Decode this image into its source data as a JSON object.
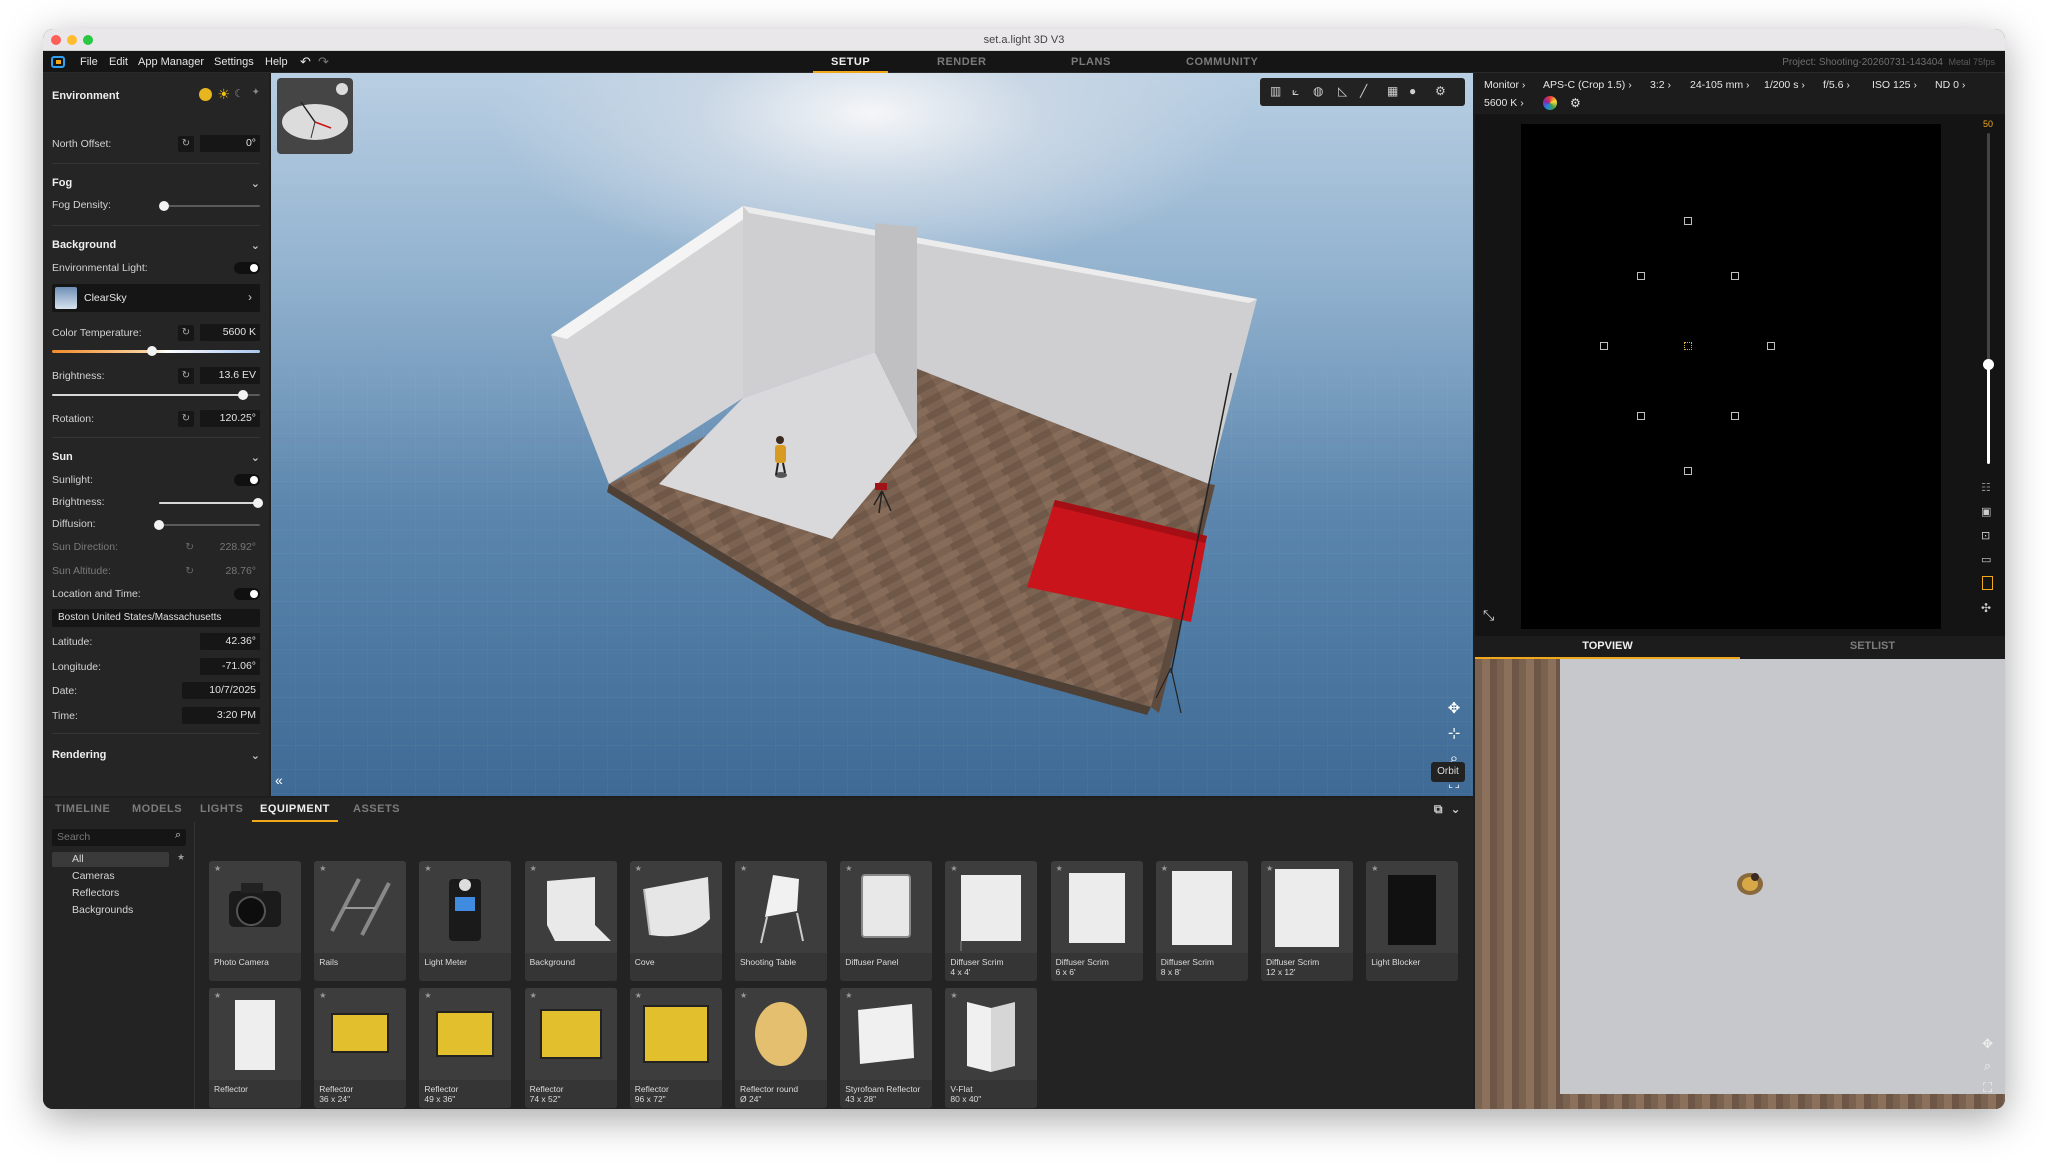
{
  "window": {
    "title": "set.a.light 3D V3"
  },
  "menu": {
    "items": [
      "File",
      "Edit",
      "App Manager",
      "Settings",
      "Help"
    ],
    "undo": "↶",
    "redo": "↷"
  },
  "modes": {
    "setup": "SETUP",
    "render": "RENDER",
    "plans": "PLANS",
    "community": "COMMUNITY"
  },
  "project": {
    "label": "Project: Shooting-20260731-143404",
    "fps": "Metal 75fps"
  },
  "environment": {
    "title": "Environment",
    "north_offset_label": "North Offset:",
    "north_offset": "0°",
    "fog_title": "Fog",
    "fog_density_label": "Fog Density:",
    "fog_density": 0.0,
    "background_title": "Background",
    "env_light_label": "Environmental Light:",
    "sky_name": "ClearSky",
    "color_temp_label": "Color Temperature:",
    "color_temp": "5600 K",
    "color_temp_level": 0.48,
    "brightness_label": "Brightness:",
    "brightness": "13.6 EV",
    "brightness_level": 0.92,
    "rotation_label": "Rotation:",
    "rotation": "120.25°",
    "sun_title": "Sun",
    "sunlight_label": "Sunlight:",
    "sun_brightness_label": "Brightness:",
    "sun_brightness_level": 0.98,
    "diffusion_label": "Diffusion:",
    "diffusion_level": 0.0,
    "sun_direction_label": "Sun Direction:",
    "sun_direction": "228.92°",
    "sun_altitude_label": "Sun Altitude:",
    "sun_altitude": "28.76°",
    "location_time_label": "Location and Time:",
    "location": "Boston United States/Massachusetts",
    "latitude_label": "Latitude:",
    "latitude": "42.36°",
    "longitude_label": "Longitude:",
    "longitude": "-71.06°",
    "date_label": "Date:",
    "date": "10/7/2025",
    "time_label": "Time:",
    "time": "3:20 PM",
    "rendering_title": "Rendering"
  },
  "viewport": {
    "orbit_label": "Orbit",
    "collapse": "«"
  },
  "camera": {
    "chips": [
      "Monitor",
      "APS-C (Crop 1.5)",
      "3:2",
      "24-105 mm",
      "1/200 s",
      "f/5.6",
      "ISO 125",
      "ND 0"
    ],
    "kelvin": "5600 K",
    "zoom_level": "50"
  },
  "lower_tabs": {
    "topview": "TOPVIEW",
    "setlist": "SETLIST"
  },
  "bottom": {
    "tabs": [
      "TIMELINE",
      "MODELS",
      "LIGHTS",
      "EQUIPMENT",
      "ASSETS"
    ],
    "search_placeholder": "Search",
    "categories": [
      "All",
      "Cameras",
      "Reflectors",
      "Backgrounds"
    ],
    "items": [
      {
        "l1": "Photo Camera",
        "l2": ""
      },
      {
        "l1": "Rails",
        "l2": ""
      },
      {
        "l1": "Light Meter",
        "l2": ""
      },
      {
        "l1": "Background",
        "l2": ""
      },
      {
        "l1": "Cove",
        "l2": ""
      },
      {
        "l1": "Shooting Table",
        "l2": ""
      },
      {
        "l1": "Diffuser Panel",
        "l2": ""
      },
      {
        "l1": "Diffuser Scrim",
        "l2": "4 x 4'"
      },
      {
        "l1": "Diffuser Scrim",
        "l2": "6 x 6'"
      },
      {
        "l1": "Diffuser Scrim",
        "l2": "8 x 8'"
      },
      {
        "l1": "Diffuser Scrim",
        "l2": "12 x 12'"
      },
      {
        "l1": "Light Blocker",
        "l2": ""
      },
      {
        "l1": "Reflector",
        "l2": ""
      },
      {
        "l1": "Reflector",
        "l2": "36 x 24\""
      },
      {
        "l1": "Reflector",
        "l2": "49 x 36\""
      },
      {
        "l1": "Reflector",
        "l2": "74 x 52\""
      },
      {
        "l1": "Reflector",
        "l2": "96 x 72\""
      },
      {
        "l1": "Reflector round",
        "l2": "Ø 24\""
      },
      {
        "l1": "Styrofoam Reflector",
        "l2": "43 x 28\""
      },
      {
        "l1": "V-Flat",
        "l2": "80 x 40\""
      }
    ]
  },
  "colors": {
    "accent": "#f1a81b",
    "panel": "#252525",
    "mat_red": "#c8141a"
  }
}
